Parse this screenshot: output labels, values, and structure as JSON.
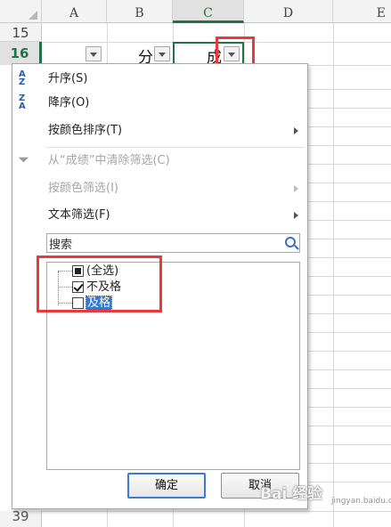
{
  "sheet": {
    "columns": [
      "A",
      "B",
      "C",
      "D",
      "E"
    ],
    "rows": [
      "15",
      "16",
      "39"
    ],
    "cells": {
      "b16": "分",
      "c16": "成"
    }
  },
  "filter_menu": {
    "items": [
      {
        "label": "升序(S)",
        "icon": "sort-ascending-icon",
        "disabled": false,
        "submenu": false
      },
      {
        "label": "降序(O)",
        "icon": "sort-descending-icon",
        "disabled": false,
        "submenu": false
      },
      {
        "label": "按颜色排序(T)",
        "disabled": false,
        "submenu": true
      },
      {
        "label": "从“成绩”中清除筛选(C)",
        "icon": "clear-filter-icon",
        "disabled": true,
        "submenu": false
      },
      {
        "label": "按颜色筛选(I)",
        "disabled": true,
        "submenu": true
      },
      {
        "label": "文本筛选(F)",
        "disabled": false,
        "submenu": true
      }
    ],
    "search": {
      "placeholder": "搜索",
      "icon": "search-icon"
    },
    "checklist": [
      {
        "label": "(全选)",
        "state": "partial"
      },
      {
        "label": "不及格",
        "state": "checked"
      },
      {
        "label": "及格",
        "state": "unchecked",
        "highlighted": true
      }
    ],
    "buttons": {
      "ok": "确定",
      "cancel": "取消"
    }
  },
  "watermark": {
    "text": "Bai 经验",
    "sub": "jingyan.baidu.com"
  },
  "colors": {
    "accent_green": "#217346",
    "highlight_red": "#e83a3a",
    "selection_blue": "#3078d6"
  }
}
